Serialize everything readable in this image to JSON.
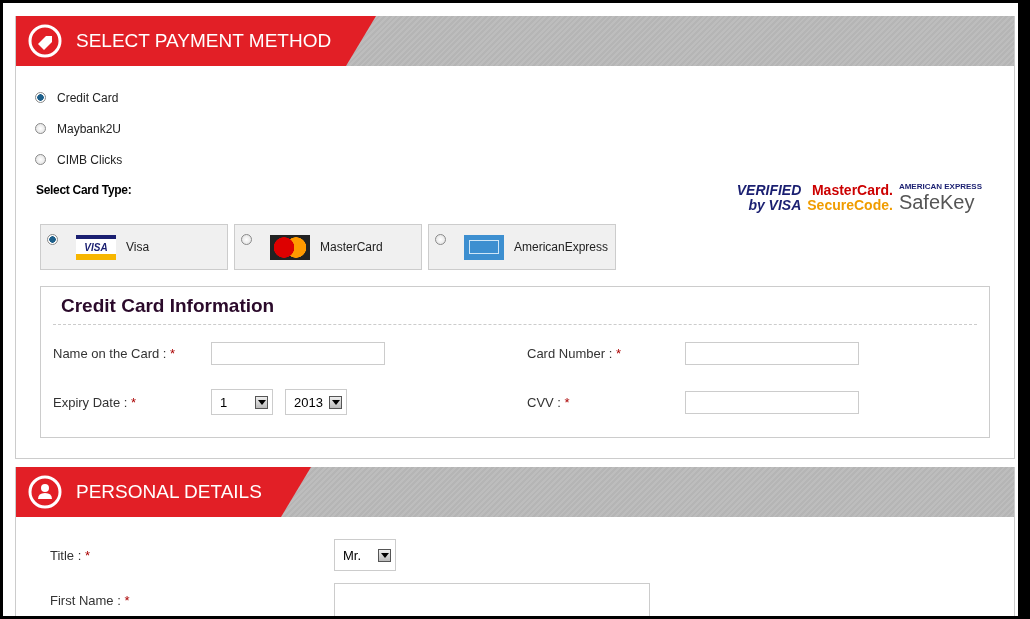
{
  "payment": {
    "title": "SELECT PAYMENT METHOD",
    "methods": [
      {
        "label": "Credit Card",
        "selected": true
      },
      {
        "label": "Maybank2U",
        "selected": false
      },
      {
        "label": "CIMB Clicks",
        "selected": false
      }
    ],
    "card_type_label": "Select Card Type:",
    "security_logos": [
      {
        "kind": "visa",
        "line_1": "VERIFIED",
        "line_2": "by VISA"
      },
      {
        "kind": "mastercard",
        "line_1": "MasterCard.",
        "line_2": "SecureCode."
      },
      {
        "kind": "amex",
        "line_1": "AMERICAN EXPRESS",
        "line_2": "SafeKey"
      }
    ],
    "cards": [
      {
        "kind": "visa",
        "label": "Visa",
        "logo_text": "VISA",
        "selected": true
      },
      {
        "kind": "mastercard",
        "label": "MasterCard",
        "selected": false
      },
      {
        "kind": "amex",
        "label": "AmericanExpress",
        "selected": false
      }
    ],
    "card_info": {
      "title": "Credit Card Information",
      "name_label": "Name on the Card :",
      "number_label": "Card Number :",
      "expiry_label": "Expiry Date :",
      "cvv_label": "CVV :",
      "required": "*",
      "expiry_month": "1",
      "expiry_year": "2013"
    }
  },
  "personal": {
    "title": "PERSONAL DETAILS",
    "title_label": "Title :",
    "title_value": "Mr.",
    "first_name_label": "First Name :",
    "required": "*"
  }
}
